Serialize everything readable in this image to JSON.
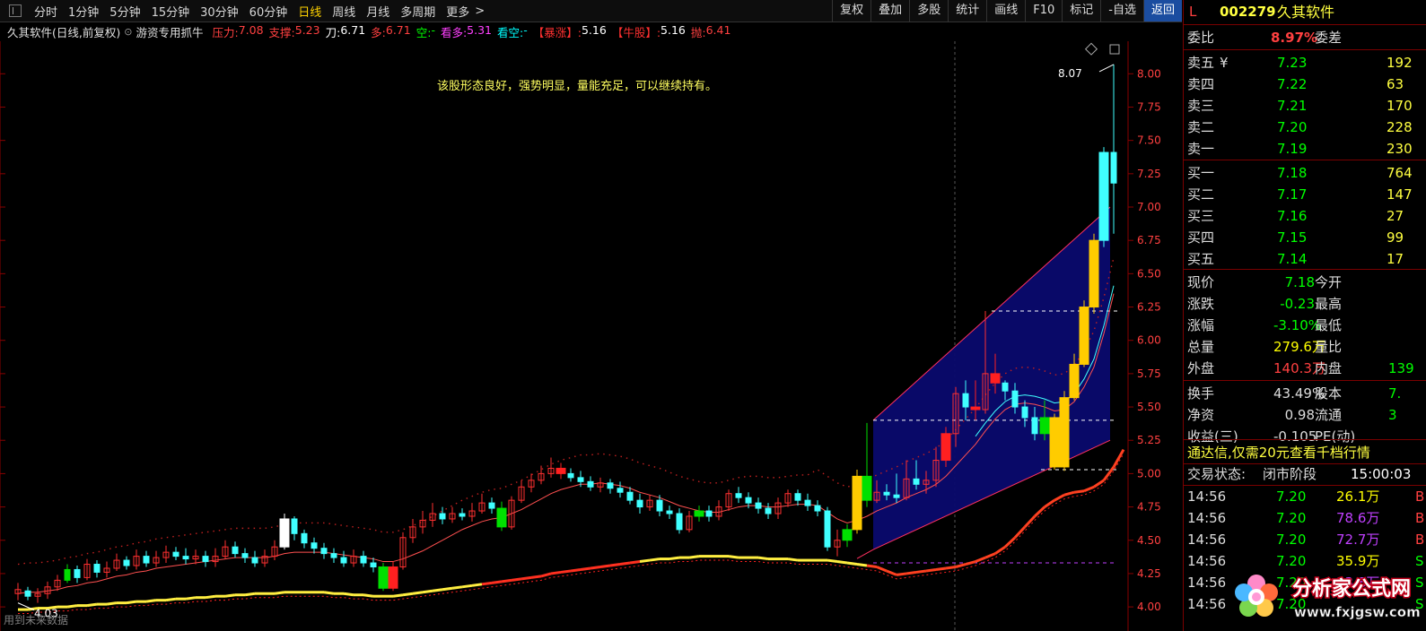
{
  "toolbar": {
    "tabs": [
      "分时",
      "1分钟",
      "5分钟",
      "15分钟",
      "30分钟",
      "60分钟",
      "日线",
      "周线",
      "月线",
      "多周期",
      "更多"
    ],
    "active_tab": "日线",
    "more_arrow": ">",
    "buttons": [
      "复权",
      "叠加",
      "多股",
      "统计",
      "画线",
      "F10",
      "标记",
      "-自选",
      "返回"
    ]
  },
  "infobar": {
    "stock": "久其软件(日线,前复权)",
    "indicator": "游资专用抓牛",
    "items": [
      {
        "label": "压力:",
        "value": "7.08",
        "lc": "#ff4040",
        "vc": "#ff4040"
      },
      {
        "label": "支撑:",
        "value": "5.23",
        "lc": "#ff4040",
        "vc": "#ff4040"
      },
      {
        "label": "刀:",
        "value": "6.71",
        "lc": "#ffffff",
        "vc": "#ffffff"
      },
      {
        "label": "多:",
        "value": "6.71",
        "lc": "#ff4040",
        "vc": "#ff4040"
      },
      {
        "label": "空:",
        "value": "-",
        "lc": "#00ff00",
        "vc": "#00ff00"
      },
      {
        "label": "看多:",
        "value": "5.31",
        "lc": "#ff40ff",
        "vc": "#ff40ff"
      },
      {
        "label": "看空:",
        "value": "-",
        "lc": "#00ffff",
        "vc": "#00ffff"
      },
      {
        "label": "【暴涨】:",
        "value": "5.16",
        "lc": "#ff3030",
        "vc": "#ffffff"
      },
      {
        "label": "【牛股】:",
        "value": "5.16",
        "lc": "#ff3030",
        "vc": "#ffffff"
      },
      {
        "label": "抛:",
        "value": "6.41",
        "lc": "#ff4040",
        "vc": "#ff4040"
      }
    ]
  },
  "chart_data": {
    "type": "candlestick",
    "annotation": "该股形态良好，强势明显，量能充足，可以继续持有。",
    "high_label": "8.07",
    "low_label": "4.03",
    "bottom_text": "用到未来数据",
    "y_ticks": [
      "8.00",
      "7.75",
      "7.50",
      "7.25",
      "7.00",
      "6.75",
      "6.50",
      "6.25",
      "6.00",
      "5.75",
      "5.50",
      "5.25",
      "5.00",
      "4.75",
      "4.50",
      "4.25",
      "4.00"
    ],
    "ylim": [
      3.92,
      8.15
    ],
    "candles": [
      [
        4.1,
        4.13,
        4.05,
        4.18
      ],
      [
        4.12,
        4.08,
        4.05,
        4.15
      ],
      [
        4.08,
        4.1,
        4.03,
        4.14
      ],
      [
        4.1,
        4.15,
        4.06,
        4.19
      ],
      [
        4.15,
        4.2,
        4.12,
        4.24
      ],
      [
        4.2,
        4.28,
        4.18,
        4.32
      ],
      [
        4.28,
        4.22,
        4.18,
        4.31
      ],
      [
        4.22,
        4.32,
        4.2,
        4.36
      ],
      [
        4.32,
        4.26,
        4.22,
        4.35
      ],
      [
        4.26,
        4.29,
        4.22,
        4.34
      ],
      [
        4.29,
        4.35,
        4.27,
        4.4
      ],
      [
        4.35,
        4.31,
        4.28,
        4.38
      ],
      [
        4.31,
        4.38,
        4.28,
        4.43
      ],
      [
        4.38,
        4.33,
        4.3,
        4.42
      ],
      [
        4.33,
        4.37,
        4.3,
        4.42
      ],
      [
        4.37,
        4.41,
        4.33,
        4.46
      ],
      [
        4.41,
        4.38,
        4.35,
        4.45
      ],
      [
        4.38,
        4.36,
        4.32,
        4.44
      ],
      [
        4.36,
        4.38,
        4.32,
        4.43
      ],
      [
        4.38,
        4.34,
        4.3,
        4.42
      ],
      [
        4.34,
        4.38,
        4.3,
        4.44
      ],
      [
        4.38,
        4.45,
        4.36,
        4.5
      ],
      [
        4.45,
        4.4,
        4.37,
        4.49
      ],
      [
        4.4,
        4.37,
        4.33,
        4.44
      ],
      [
        4.37,
        4.33,
        4.3,
        4.42
      ],
      [
        4.33,
        4.38,
        4.3,
        4.43
      ],
      [
        4.38,
        4.45,
        4.35,
        4.5
      ],
      [
        4.45,
        4.66,
        4.43,
        4.7
      ],
      [
        4.66,
        4.55,
        4.5,
        4.68
      ],
      [
        4.55,
        4.48,
        4.44,
        4.58
      ],
      [
        4.48,
        4.44,
        4.4,
        4.52
      ],
      [
        4.44,
        4.4,
        4.36,
        4.48
      ],
      [
        4.4,
        4.37,
        4.33,
        4.44
      ],
      [
        4.37,
        4.33,
        4.3,
        4.42
      ],
      [
        4.33,
        4.38,
        4.3,
        4.43
      ],
      [
        4.38,
        4.33,
        4.3,
        4.42
      ],
      [
        4.33,
        4.3,
        4.26,
        4.37
      ],
      [
        4.3,
        4.14,
        4.12,
        4.33
      ],
      [
        4.14,
        4.3,
        4.12,
        4.34
      ],
      [
        4.3,
        4.52,
        4.28,
        4.56
      ],
      [
        4.52,
        4.6,
        4.48,
        4.66
      ],
      [
        4.6,
        4.65,
        4.55,
        4.72
      ],
      [
        4.65,
        4.7,
        4.6,
        4.78
      ],
      [
        4.7,
        4.66,
        4.62,
        4.75
      ],
      [
        4.66,
        4.7,
        4.63,
        4.75
      ],
      [
        4.7,
        4.68,
        4.65,
        4.74
      ],
      [
        4.68,
        4.72,
        4.64,
        4.78
      ],
      [
        4.72,
        4.78,
        4.7,
        4.85
      ],
      [
        4.78,
        4.74,
        4.7,
        4.82
      ],
      [
        4.74,
        4.6,
        4.57,
        4.79
      ],
      [
        4.6,
        4.8,
        4.58,
        4.83
      ],
      [
        4.8,
        4.9,
        4.78,
        4.95
      ],
      [
        4.9,
        4.95,
        4.86,
        5.0
      ],
      [
        4.95,
        5.0,
        4.92,
        5.06
      ],
      [
        5.0,
        5.04,
        4.97,
        5.12
      ],
      [
        5.04,
        5.0,
        4.96,
        5.08
      ],
      [
        5.0,
        4.97,
        4.94,
        5.04
      ],
      [
        4.97,
        4.94,
        4.9,
        5.02
      ],
      [
        4.94,
        4.9,
        4.87,
        4.98
      ],
      [
        4.9,
        4.93,
        4.86,
        4.97
      ],
      [
        4.93,
        4.89,
        4.85,
        4.96
      ],
      [
        4.89,
        4.86,
        4.82,
        4.94
      ],
      [
        4.86,
        4.8,
        4.77,
        4.9
      ],
      [
        4.8,
        4.75,
        4.7,
        4.85
      ],
      [
        4.75,
        4.8,
        4.72,
        4.84
      ],
      [
        4.8,
        4.72,
        4.68,
        4.84
      ],
      [
        4.72,
        4.7,
        4.66,
        4.76
      ],
      [
        4.7,
        4.58,
        4.55,
        4.74
      ],
      [
        4.58,
        4.68,
        4.56,
        4.72
      ],
      [
        4.68,
        4.72,
        4.64,
        4.76
      ],
      [
        4.72,
        4.68,
        4.64,
        4.76
      ],
      [
        4.68,
        4.75,
        4.65,
        4.8
      ],
      [
        4.75,
        4.85,
        4.72,
        4.88
      ],
      [
        4.85,
        4.82,
        4.78,
        4.9
      ],
      [
        4.82,
        4.78,
        4.74,
        4.86
      ],
      [
        4.78,
        4.74,
        4.7,
        4.82
      ],
      [
        4.74,
        4.7,
        4.66,
        4.78
      ],
      [
        4.7,
        4.78,
        4.66,
        4.82
      ],
      [
        4.78,
        4.85,
        4.75,
        4.88
      ],
      [
        4.85,
        4.8,
        4.76,
        4.88
      ],
      [
        4.8,
        4.76,
        4.72,
        4.85
      ],
      [
        4.76,
        4.72,
        4.68,
        4.8
      ],
      [
        4.72,
        4.45,
        4.42,
        4.75
      ],
      [
        4.45,
        4.5,
        4.38,
        4.58
      ],
      [
        4.5,
        4.58,
        4.45,
        4.62
      ],
      [
        4.58,
        4.98,
        4.55,
        5.03
      ],
      [
        4.98,
        4.8,
        4.75,
        5.38
      ],
      [
        4.8,
        4.86,
        4.78,
        4.95
      ],
      [
        4.86,
        4.84,
        4.8,
        4.92
      ],
      [
        4.84,
        4.82,
        4.78,
        5.0
      ],
      [
        4.82,
        4.96,
        4.8,
        5.1
      ],
      [
        4.96,
        4.92,
        4.88,
        5.1
      ],
      [
        4.92,
        4.95,
        4.85,
        5.02
      ],
      [
        4.95,
        5.1,
        4.9,
        5.2
      ],
      [
        5.1,
        5.3,
        5.05,
        5.35
      ],
      [
        5.3,
        5.6,
        5.2,
        5.65
      ],
      [
        5.6,
        5.5,
        5.4,
        5.7
      ],
      [
        5.5,
        5.48,
        5.4,
        5.7
      ],
      [
        5.48,
        5.75,
        5.45,
        6.22
      ],
      [
        5.75,
        5.68,
        5.6,
        5.9
      ],
      [
        5.68,
        5.62,
        5.55,
        5.7
      ],
      [
        5.62,
        5.5,
        5.45,
        5.68
      ],
      [
        5.5,
        5.42,
        5.35,
        5.55
      ],
      [
        5.42,
        5.3,
        5.25,
        5.5
      ],
      [
        5.3,
        5.42,
        5.25,
        5.55
      ],
      [
        5.42,
        5.05,
        5.03,
        5.45
      ],
      [
        5.05,
        5.57,
        5.02,
        5.62
      ],
      [
        5.57,
        5.82,
        5.55,
        5.9
      ],
      [
        5.82,
        6.25,
        5.8,
        6.3
      ],
      [
        6.25,
        6.75,
        6.2,
        6.8
      ],
      [
        6.75,
        7.41,
        6.7,
        7.45
      ],
      [
        7.41,
        7.18,
        6.8,
        8.07
      ]
    ],
    "ma": [
      4.1,
      4.11,
      4.11,
      4.12,
      4.13,
      4.15,
      4.16,
      4.18,
      4.19,
      4.21,
      4.23,
      4.24,
      4.26,
      4.27,
      4.29,
      4.3,
      4.31,
      4.32,
      4.33,
      4.34,
      4.35,
      4.36,
      4.37,
      4.37,
      4.37,
      4.37,
      4.38,
      4.4,
      4.41,
      4.41,
      4.41,
      4.41,
      4.4,
      4.39,
      4.38,
      4.37,
      4.36,
      4.34,
      4.34,
      4.36,
      4.39,
      4.42,
      4.46,
      4.5,
      4.54,
      4.58,
      4.61,
      4.64,
      4.66,
      4.67,
      4.7,
      4.73,
      4.77,
      4.81,
      4.85,
      4.88,
      4.9,
      4.92,
      4.92,
      4.93,
      4.92,
      4.91,
      4.89,
      4.86,
      4.84,
      4.82,
      4.79,
      4.76,
      4.74,
      4.72,
      4.71,
      4.71,
      4.73,
      4.75,
      4.76,
      4.76,
      4.75,
      4.75,
      4.76,
      4.77,
      4.77,
      4.76,
      4.71,
      4.66,
      4.63,
      4.65,
      4.68,
      4.72,
      4.75,
      4.78,
      4.82,
      4.85,
      4.88,
      4.92,
      4.98,
      5.06,
      5.14,
      5.22,
      5.32,
      5.41,
      5.48,
      5.52,
      5.53,
      5.52,
      5.5,
      5.47,
      5.48,
      5.54,
      5.65,
      5.8,
      6.05,
      6.35
    ],
    "long_ma": [
      3.98,
      3.98,
      3.99,
      3.99,
      4.0,
      4.0,
      4.01,
      4.01,
      4.02,
      4.02,
      4.03,
      4.03,
      4.04,
      4.04,
      4.05,
      4.05,
      4.06,
      4.06,
      4.07,
      4.07,
      4.08,
      4.08,
      4.09,
      4.09,
      4.1,
      4.1,
      4.1,
      4.11,
      4.11,
      4.11,
      4.11,
      4.11,
      4.1,
      4.1,
      4.09,
      4.09,
      4.08,
      4.08,
      4.08,
      4.09,
      4.1,
      4.11,
      4.12,
      4.13,
      4.14,
      4.15,
      4.16,
      4.17,
      4.18,
      4.19,
      4.2,
      4.21,
      4.22,
      4.23,
      4.25,
      4.26,
      4.27,
      4.28,
      4.29,
      4.3,
      4.31,
      4.32,
      4.33,
      4.34,
      4.35,
      4.36,
      4.36,
      4.37,
      4.37,
      4.38,
      4.38,
      4.38,
      4.38,
      4.37,
      4.37,
      4.37,
      4.36,
      4.36,
      4.36,
      4.35,
      4.35,
      4.35,
      4.35,
      4.34,
      4.33,
      4.32,
      4.31,
      4.3,
      4.27,
      4.24,
      4.25,
      4.26,
      4.27,
      4.28,
      4.29,
      4.3,
      4.32,
      4.34,
      4.37,
      4.4,
      4.45,
      4.52,
      4.6,
      4.68,
      4.75,
      4.8,
      4.84,
      4.86,
      4.87,
      4.9,
      4.95,
      5.05,
      5.18
    ],
    "channel": {
      "start": 87,
      "end": 111,
      "upper": [
        5.4,
        7.0
      ],
      "lower": [
        4.43,
        5.25
      ]
    },
    "dashed_levels": [
      {
        "y": 6.22,
        "from": 99,
        "to": 111
      },
      {
        "y": 5.4,
        "from": 87,
        "to": 111
      },
      {
        "y": 5.03,
        "from": 104,
        "to": 111
      },
      {
        "y": 4.33,
        "from": 87,
        "to": 111
      }
    ]
  },
  "panel": {
    "code_letter": "L",
    "code": "002279",
    "name": "久其软件",
    "weibi_label": "委比",
    "weibi_value": "8.97%",
    "weicha_label": "委差",
    "asks": [
      {
        "label": "卖五",
        "sym": "¥",
        "price": "7.23",
        "vol": "192"
      },
      {
        "label": "卖四",
        "sym": "",
        "price": "7.22",
        "vol": "63"
      },
      {
        "label": "卖三",
        "sym": "",
        "price": "7.21",
        "vol": "170"
      },
      {
        "label": "卖二",
        "sym": "",
        "price": "7.20",
        "vol": "228"
      },
      {
        "label": "卖一",
        "sym": "",
        "price": "7.19",
        "vol": "230"
      }
    ],
    "bids": [
      {
        "label": "买一",
        "price": "7.18",
        "vol": "764"
      },
      {
        "label": "买二",
        "price": "7.17",
        "vol": "147"
      },
      {
        "label": "买三",
        "price": "7.16",
        "vol": "27"
      },
      {
        "label": "买四",
        "price": "7.15",
        "vol": "99"
      },
      {
        "label": "买五",
        "price": "7.14",
        "vol": "17"
      }
    ],
    "stats": [
      {
        "l1": "现价",
        "v1": "7.18",
        "c1": "#00ff00",
        "l2": "今开",
        "v2": ""
      },
      {
        "l1": "涨跌",
        "v1": "-0.23",
        "c1": "#00ff00",
        "l2": "最高",
        "v2": ""
      },
      {
        "l1": "涨幅",
        "v1": "-3.10%",
        "c1": "#00ff00",
        "l2": "最低",
        "v2": ""
      },
      {
        "l1": "总量",
        "v1": "279.6万",
        "c1": "#ffff00",
        "l2": "量比",
        "v2": ""
      },
      {
        "l1": "外盘",
        "v1": "140.3万",
        "c1": "#ff4040",
        "l2": "内盘",
        "v2": "139"
      },
      {
        "l1": "换手",
        "v1": "43.49%",
        "c1": "#dddddd",
        "l2": "股本",
        "v2": "7."
      },
      {
        "l1": "净资",
        "v1": "0.98",
        "c1": "#dddddd",
        "l2": "流通",
        "v2": "3"
      },
      {
        "l1": "收益(三)",
        "v1": "-0.105",
        "c1": "#dddddd",
        "l2": "PE(动)",
        "v2": ""
      }
    ],
    "promo": "通达信,仅需20元查看千档行情",
    "trade_status_label": "交易状态:",
    "trade_status": "闭市阶段",
    "trade_time": "15:00:03",
    "ticks": [
      {
        "time": "14:56",
        "price": "7.20",
        "vol": "26.1万",
        "vc": "#ffff00",
        "side": "B",
        "sc": "#ff4040"
      },
      {
        "time": "14:56",
        "price": "7.20",
        "vol": "78.6万",
        "vc": "#c040ff",
        "side": "B",
        "sc": "#ff4040"
      },
      {
        "time": "14:56",
        "price": "7.20",
        "vol": "72.7万",
        "vc": "#c040ff",
        "side": "B",
        "sc": "#ff4040"
      },
      {
        "time": "14:56",
        "price": "7.20",
        "vol": "35.9万",
        "vc": "#ffff00",
        "side": "S",
        "sc": "#00ff00"
      },
      {
        "time": "14:56",
        "price": "7.20",
        "vol": "53.8万",
        "vc": "#c040ff",
        "side": "S",
        "sc": "#00ff00"
      },
      {
        "time": "14:56",
        "price": "7.20",
        "vol": "",
        "vc": "#ffff00",
        "side": "S",
        "sc": "#00ff00"
      }
    ]
  },
  "watermark": {
    "title": "分析家公式网",
    "url": "www.fxjgsw.com"
  }
}
